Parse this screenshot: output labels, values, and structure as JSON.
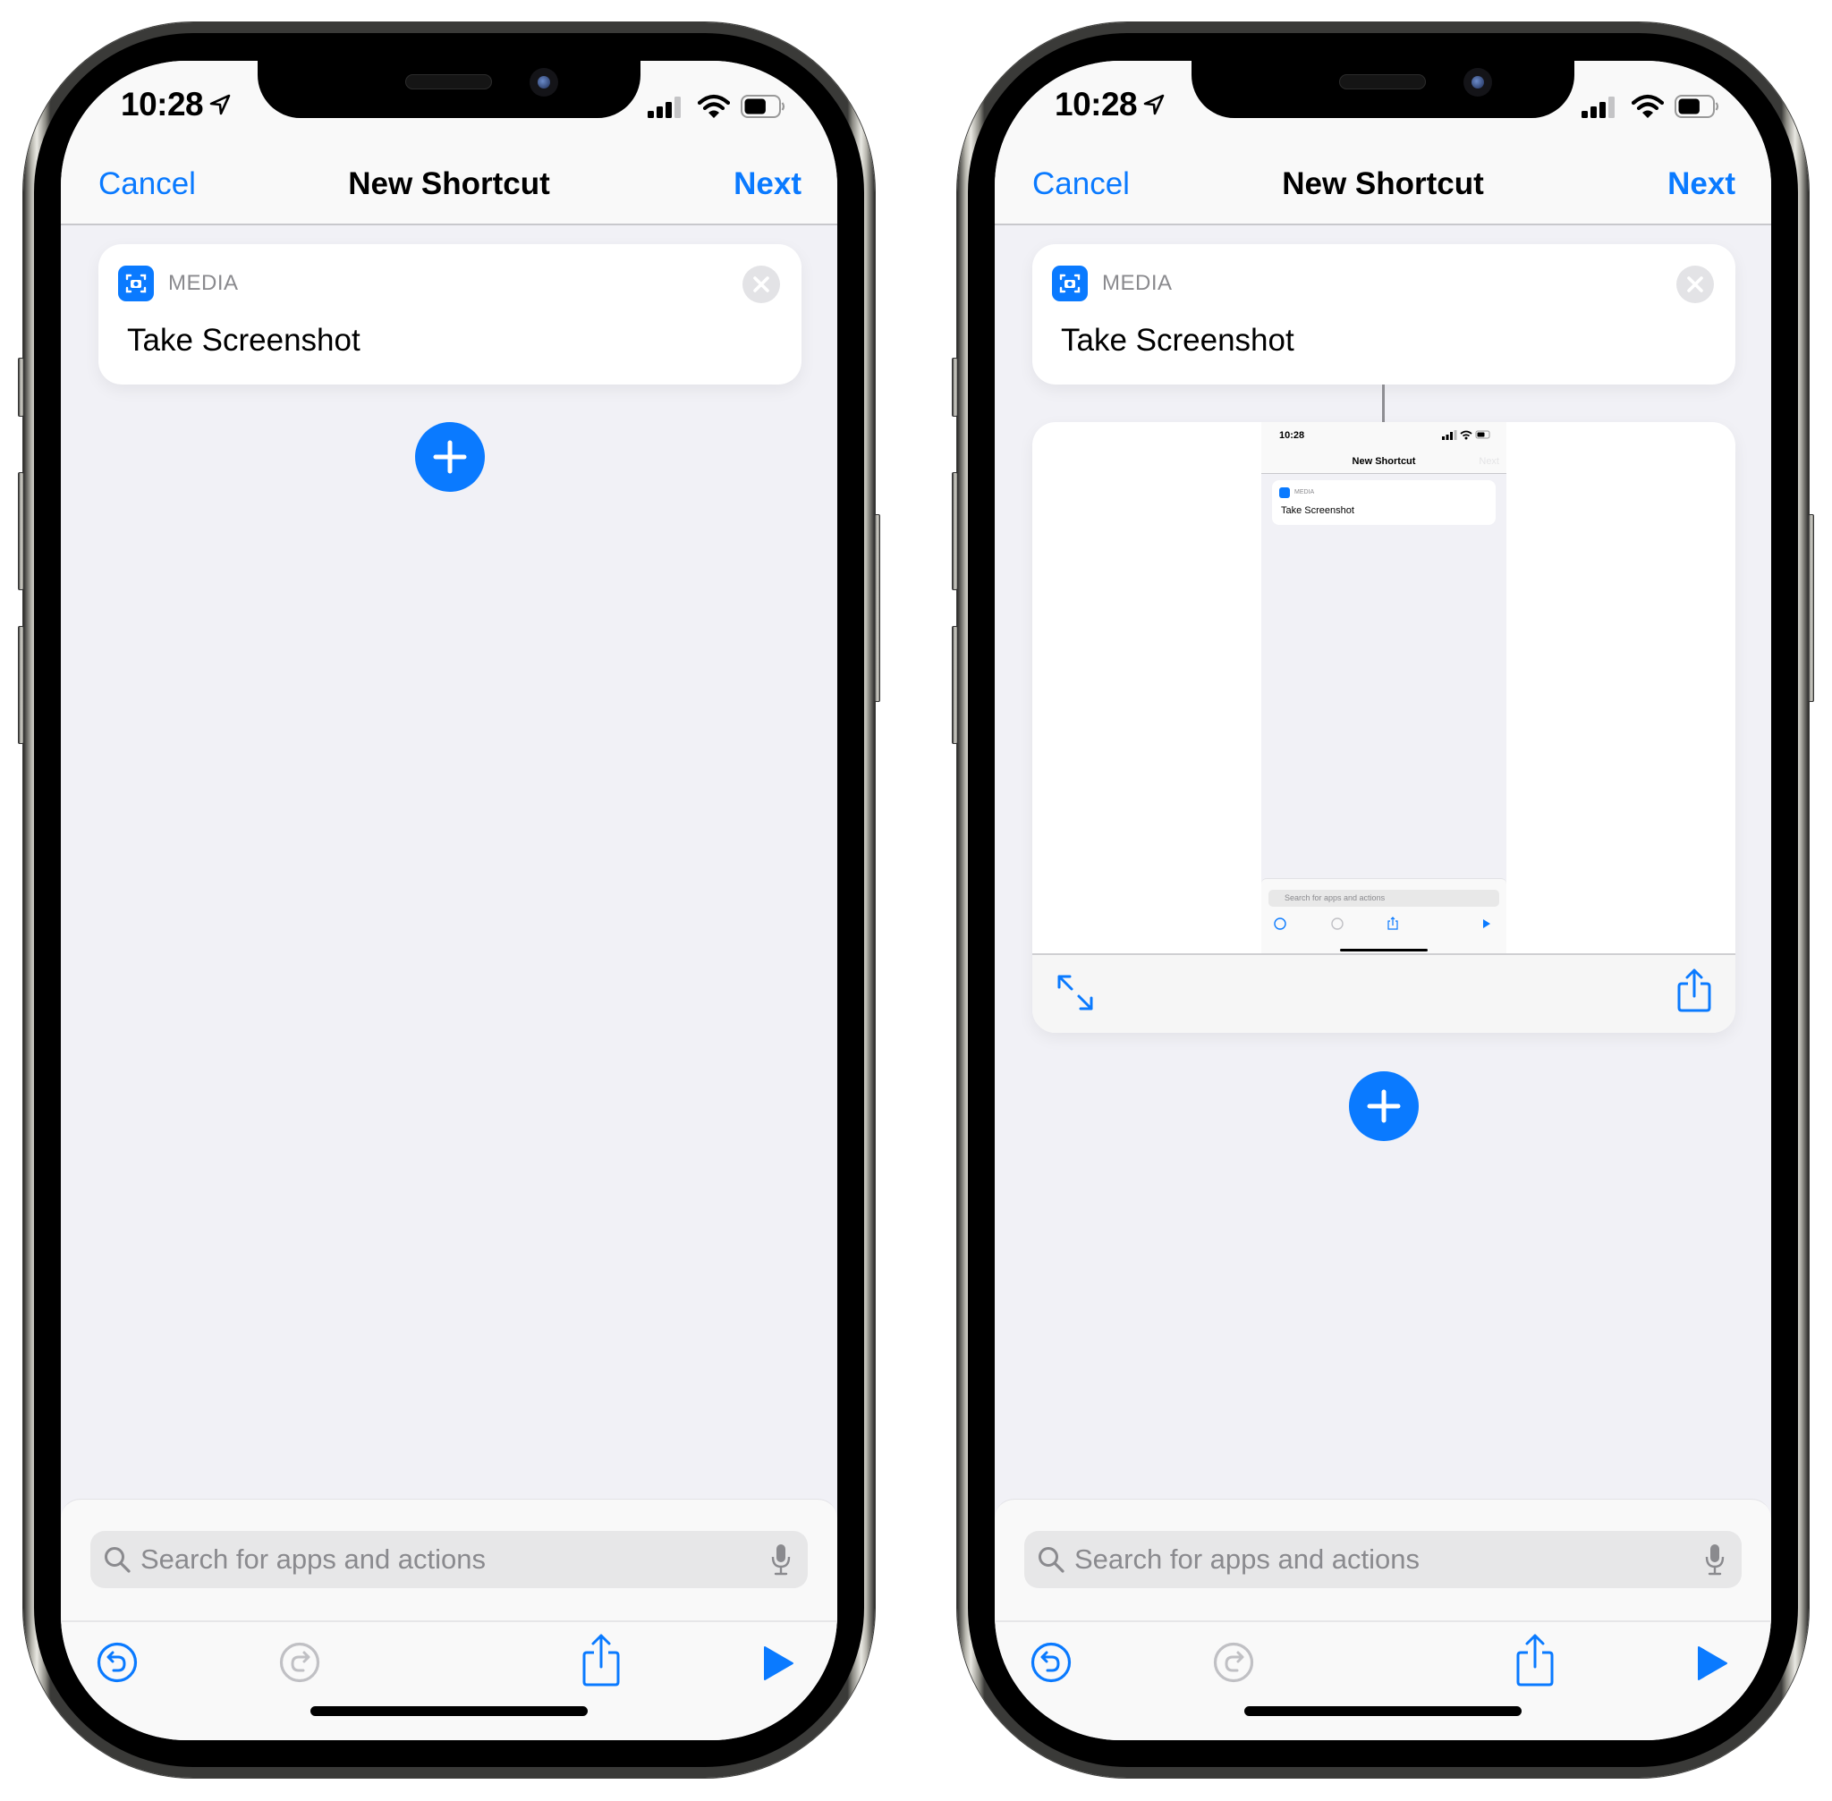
{
  "colors": {
    "accent": "#0a7aff",
    "background": "#f1f1f6",
    "disabled": "#c0c0c4"
  },
  "phones": [
    {
      "status": {
        "time": "10:28",
        "location_icon": "location-arrow-icon",
        "signal_bars": 3,
        "signal_bars_max": 4,
        "battery_percent": 65
      },
      "nav": {
        "cancel_label": "Cancel",
        "title": "New Shortcut",
        "next_label": "Next"
      },
      "action": {
        "category": "MEDIA",
        "title": "Take Screenshot",
        "icon": "screenshot-icon"
      },
      "search": {
        "placeholder": "Search for apps and actions",
        "value": ""
      },
      "toolbar": {
        "undo": "undo-icon",
        "redo": "redo-icon",
        "redo_enabled": false,
        "share": "share-icon",
        "play": "play-icon"
      }
    },
    {
      "status": {
        "time": "10:28",
        "location_icon": "location-arrow-icon",
        "signal_bars": 3,
        "signal_bars_max": 4,
        "battery_percent": 65
      },
      "nav": {
        "cancel_label": "Cancel",
        "title": "New Shortcut",
        "next_label": "Next"
      },
      "action": {
        "category": "MEDIA",
        "title": "Take Screenshot",
        "icon": "screenshot-icon"
      },
      "preview": {
        "thumbnail": {
          "time": "10:28",
          "title": "New Shortcut",
          "next_label": "Next",
          "category": "MEDIA",
          "action_title": "Take Screenshot",
          "search_placeholder": "Search for apps and actions"
        },
        "expand_icon": "expand-arrows-icon",
        "share_icon": "share-icon"
      },
      "search": {
        "placeholder": "Search for apps and actions",
        "value": ""
      },
      "toolbar": {
        "undo": "undo-icon",
        "redo": "redo-icon",
        "redo_enabled": false,
        "share": "share-icon",
        "play": "play-icon"
      }
    }
  ]
}
